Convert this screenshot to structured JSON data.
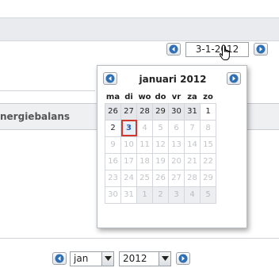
{
  "toolbar": {
    "date_value": "3-1-2012",
    "prev_icon": "arrow-left-icon",
    "next_icon": "arrow-right-icon"
  },
  "tabs": {
    "active_label": "nergiebalans"
  },
  "calendar": {
    "title": "januari 2012",
    "weekdays": [
      "ma",
      "di",
      "wo",
      "do",
      "vr",
      "za",
      "zo"
    ],
    "weeks": [
      [
        "26",
        "27",
        "28",
        "29",
        "30",
        "31",
        "1"
      ],
      [
        "2",
        "3",
        "4",
        "5",
        "6",
        "7",
        "8"
      ],
      [
        "9",
        "10",
        "11",
        "12",
        "13",
        "14",
        "15"
      ],
      [
        "16",
        "17",
        "18",
        "19",
        "20",
        "21",
        "22"
      ],
      [
        "23",
        "24",
        "25",
        "26",
        "27",
        "28",
        "29"
      ],
      [
        "30",
        "31",
        "1",
        "2",
        "3",
        "4",
        "5"
      ]
    ],
    "selected_day": "3"
  },
  "footer": {
    "month_value": "jan",
    "year_value": "2012"
  },
  "colors": {
    "selection_border": "#d03a2c",
    "nav_arrow": "#2f6fb3"
  }
}
